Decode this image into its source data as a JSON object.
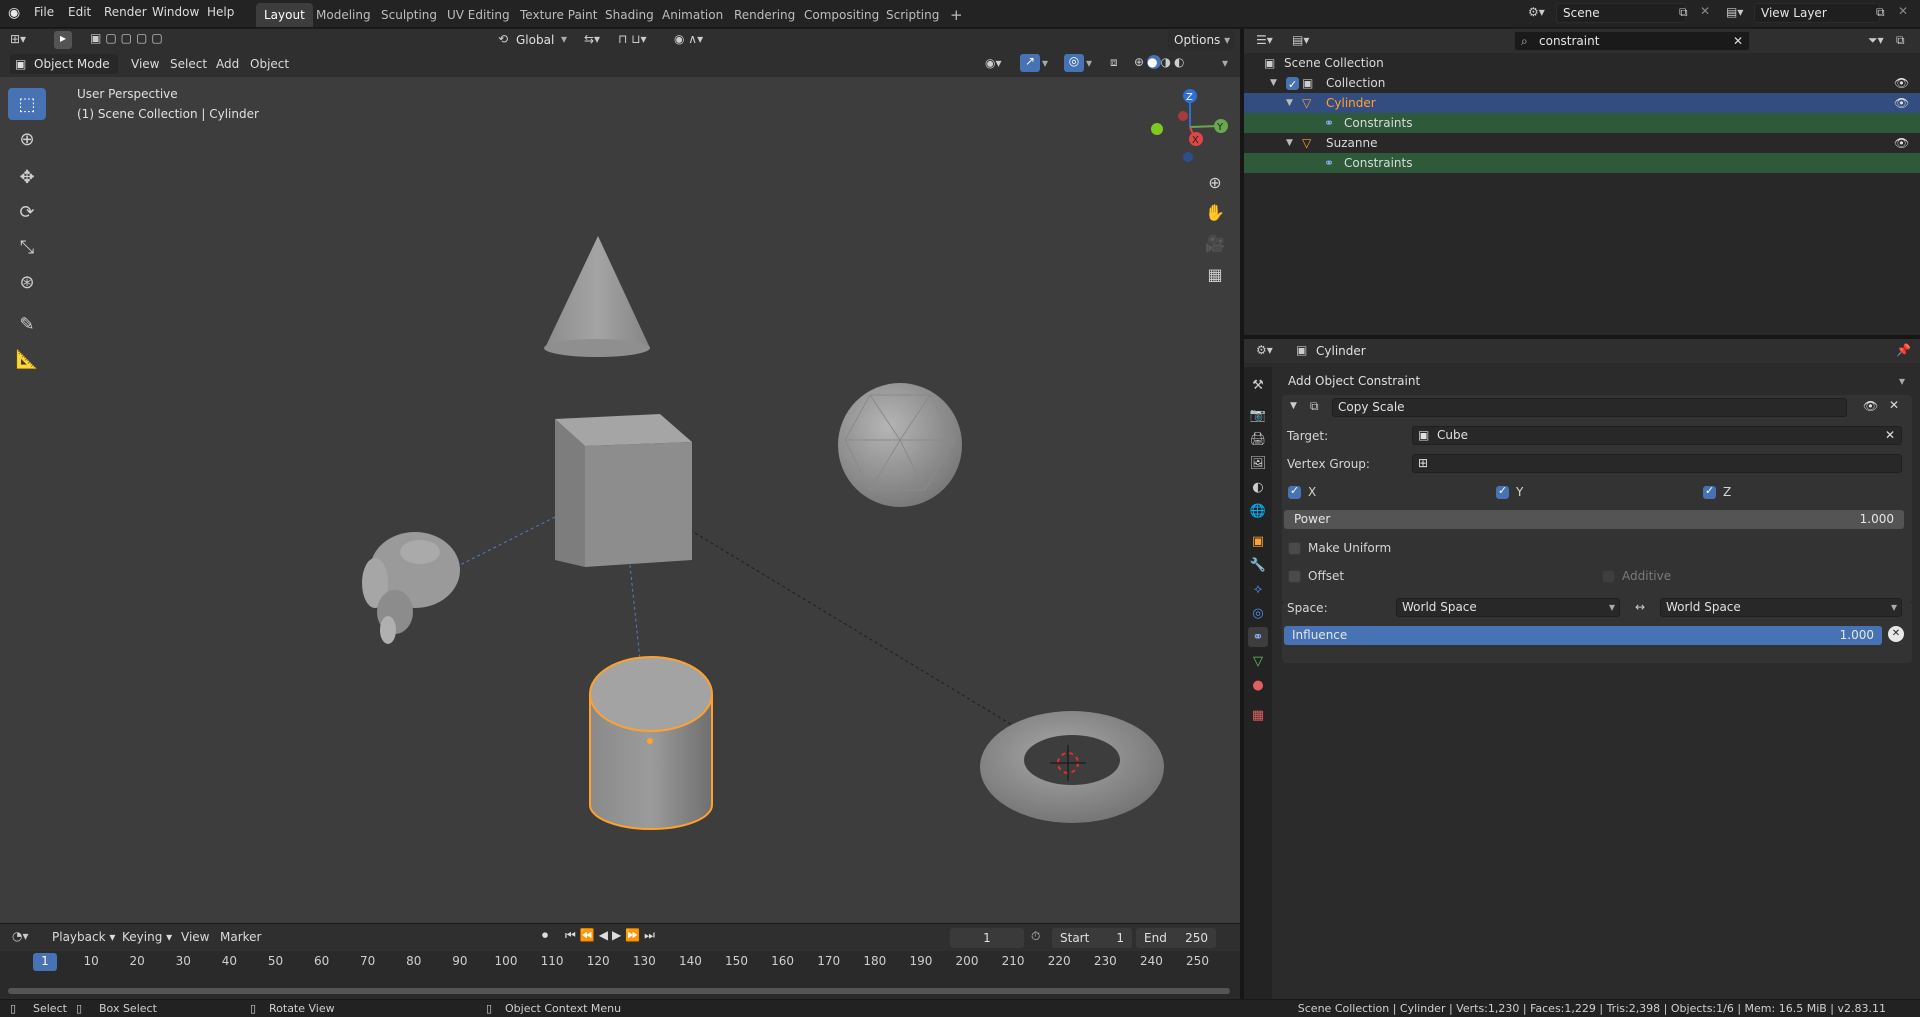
{
  "topbar": {
    "menus": [
      "File",
      "Edit",
      "Render",
      "Window",
      "Help"
    ],
    "workspaces": [
      "Layout",
      "Modeling",
      "Sculpting",
      "UV Editing",
      "Texture Paint",
      "Shading",
      "Animation",
      "Rendering",
      "Compositing",
      "Scripting"
    ],
    "active_workspace": "Layout",
    "add_tab": "+",
    "scene": "Scene",
    "view_layer": "View Layer"
  },
  "viewport": {
    "mode": "Object Mode",
    "menus": [
      "View",
      "Select",
      "Add",
      "Object"
    ],
    "orientation": "Global",
    "options_label": "Options",
    "overlay_title": "User Perspective",
    "overlay_subtitle": "(1) Scene Collection | Cylinder",
    "gizmo": {
      "z": "Z",
      "y": "Y",
      "x": "X"
    }
  },
  "timeline": {
    "menus": [
      "Playback",
      "Keying",
      "View",
      "Marker"
    ],
    "current_frame": "1",
    "start_label": "Start",
    "start": "1",
    "end_label": "End",
    "end": "250",
    "ticks": [
      "1",
      "10",
      "20",
      "30",
      "40",
      "50",
      "60",
      "70",
      "80",
      "90",
      "100",
      "110",
      "120",
      "130",
      "140",
      "150",
      "160",
      "170",
      "180",
      "190",
      "200",
      "210",
      "220",
      "230",
      "240",
      "250"
    ]
  },
  "statusbar": {
    "select": "Select",
    "box_select": "Box Select",
    "rotate": "Rotate View",
    "context": "Object Context Menu",
    "stats": "Scene Collection | Cylinder | Verts:1,230 | Faces:1,229 | Tris:2,398 | Objects:1/6 | Mem: 16.5 MiB | v2.83.11"
  },
  "outliner": {
    "search": "constraint",
    "rows": [
      "Scene Collection",
      "Collection",
      "Cylinder",
      "Constraints",
      "Suzanne",
      "Constraints"
    ]
  },
  "properties": {
    "object_name": "Cylinder",
    "add_constraint": "Add Object Constraint",
    "constraint_name": "Copy Scale",
    "target_label": "Target:",
    "target_value": "Cube",
    "vertex_group_label": "Vertex Group:",
    "axes": [
      "X",
      "Y",
      "Z"
    ],
    "power_label": "Power",
    "power_value": "1.000",
    "make_uniform": "Make Uniform",
    "offset": "Offset",
    "additive": "Additive",
    "space_label": "Space:",
    "owner_space": "World Space",
    "target_space": "World Space",
    "influence_label": "Influence",
    "influence_value": "1.000",
    "influence_fraction": 1.0
  },
  "colors": {
    "accent": "#4772b3",
    "selected": "#ffa12e",
    "outliner_highlight": "#334d80",
    "constraint_row": "#2e5a3a"
  }
}
